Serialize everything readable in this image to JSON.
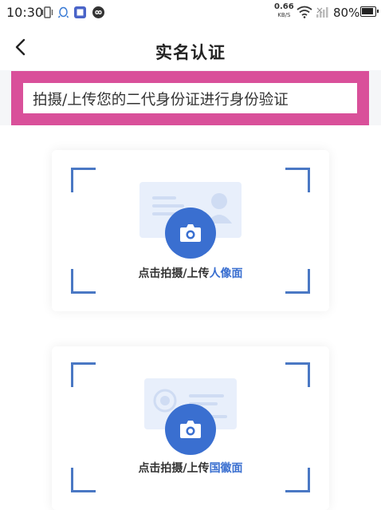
{
  "status_bar": {
    "time": "10:30",
    "net_speed_value": "0.66",
    "net_speed_unit": "KB/S",
    "battery": "80%"
  },
  "nav": {
    "title": "实名认证",
    "back_icon": "chevron-left-icon"
  },
  "instruction": {
    "text": "拍摄/上传您的二代身份证进行身份验证",
    "highlight_color": "#d9509a"
  },
  "cards": [
    {
      "caption_prefix": "点击拍摄/上传",
      "caption_highlight": "人像面",
      "icon": "camera-icon"
    },
    {
      "caption_prefix": "点击拍摄/上传",
      "caption_highlight": "国徽面",
      "icon": "camera-icon"
    }
  ],
  "colors": {
    "accent": "#3a6fd0",
    "frame": "#4a78c4"
  }
}
